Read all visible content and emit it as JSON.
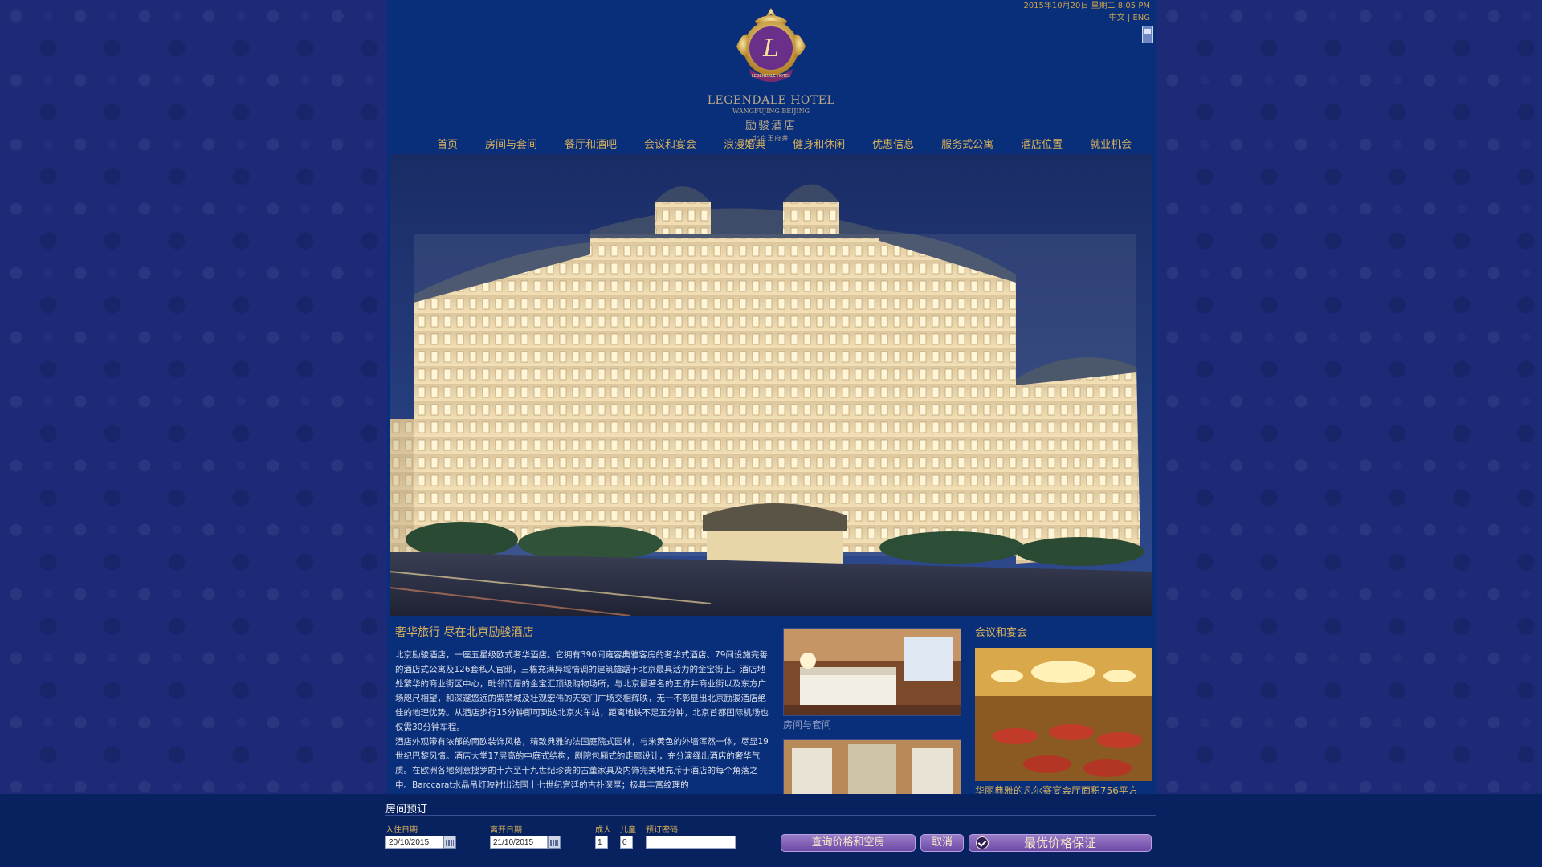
{
  "header": {
    "datetime": "2015年10月20日 星期二 8:05 PM",
    "lang_cn": "中文",
    "lang_sep": "|",
    "lang_en": "ENG"
  },
  "logo": {
    "monogram": "L",
    "ribbon": "LEGENDALE HOTEL",
    "name_en": "LEGENDALE HOTEL",
    "location_en": "WANGFUJING BEIJING",
    "name_cn": "励骏酒店",
    "location_cn": "北京王府井"
  },
  "nav": [
    "首页",
    "房间与套间",
    "餐厅和酒吧",
    "会议和宴会",
    "浪漫婚典",
    "健身和休闲",
    "优惠信息",
    "服务式公寓",
    "酒店位置",
    "就业机会"
  ],
  "intro": {
    "heading": "奢华旅行 尽在北京励骏酒店",
    "paragraph1": "北京励骏酒店，一座五星级欧式奢华酒店。它拥有390间雍容典雅客房的奢华式酒店、79间设施完善的酒店式公寓及126套私人官邸，三栋充满异域情调的建筑雄踞于北京最具活力的金宝街上。酒店地处繁华的商业街区中心，毗邻而居的金宝汇顶级购物场所，与北京最著名的王府井商业街以及东方广场咫尺相望，和深邃悠远的紫禁城及壮观宏伟的天安门广场交相辉映，无一不彰显出北京励骏酒店绝佳的地理优势。从酒店步行15分钟即可到达北京火车站，距离地铁不足五分钟，北京首都国际机场也仅需30分钟车程。",
    "paragraph2": "酒店外观带有浓郁的南欧装饰风格，精致典雅的法国庭院式园林，与米黄色的外墙浑然一体，尽显19世纪巴黎风情。酒店大堂17层高的中庭式结构，剧院包厢式的走廊设计，充分演绎出酒店的奢华气质。在欧洲各地刻意搜罗的十六至十九世纪珍贵的古董家具及内饰完美地充斥于酒店的每个角落之中。Barccarat水晶吊灯映衬出法国十七世纪宫廷的古朴深厚；极具丰富纹理的"
  },
  "rooms": {
    "caption": "房间与套间"
  },
  "meetings": {
    "heading": "会议和宴会",
    "caption": "华丽典雅的凡尔赛宴会厅面积756平方"
  },
  "booking": {
    "title": "房间预订",
    "checkin_label": "入住日期",
    "checkin_value": "20/10/2015",
    "checkout_label": "离开日期",
    "checkout_value": "21/10/2015",
    "adults_label": "成人",
    "adults_value": "1",
    "children_label": "儿童",
    "children_value": "0",
    "promo_label": "预订密码",
    "promo_value": "",
    "search_button": "查询价格和空房",
    "cancel_button": "取消",
    "best_price": "最优价格保证"
  },
  "colors": {
    "page_bg": "#1c2a78",
    "panel_bg": "#0a2f7a",
    "gold": "#d8b15b",
    "button_purple": "#7a5ab4"
  }
}
